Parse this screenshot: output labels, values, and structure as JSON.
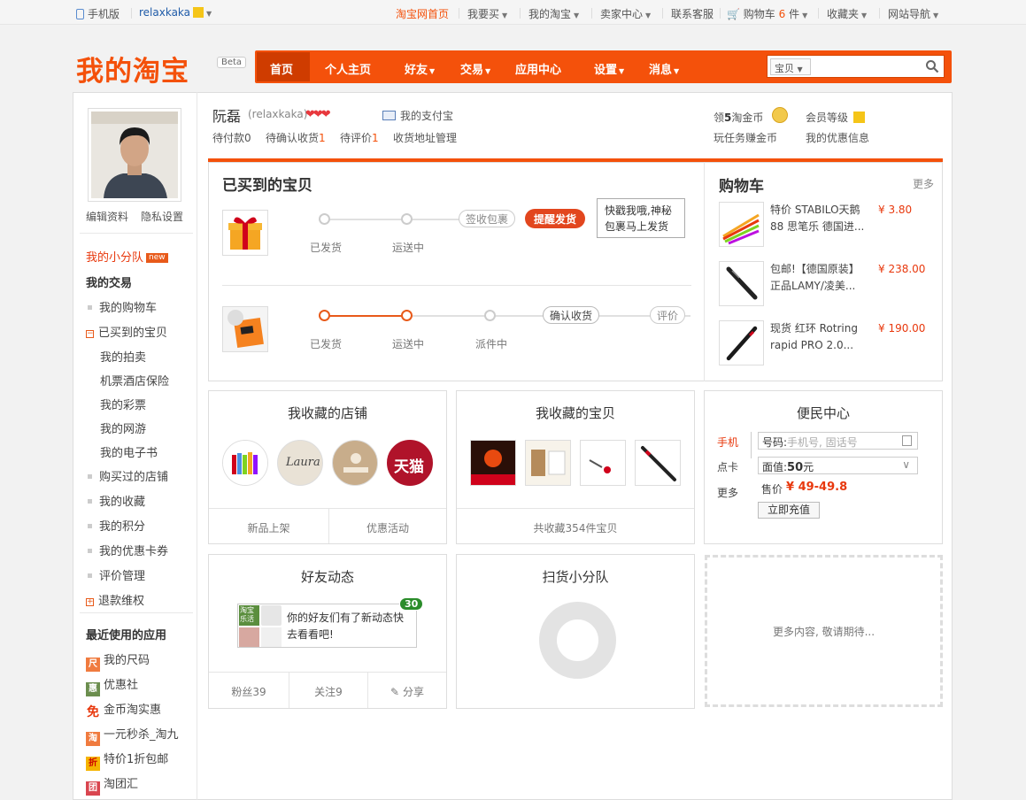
{
  "topbar": {
    "mobile": "手机版",
    "username": "relaxkaka",
    "links": [
      "淘宝网首页",
      "我要买",
      "我的淘宝",
      "卖家中心",
      "联系客服",
      "购物车",
      "收藏夹",
      "网站导航"
    ],
    "cart_count": "6",
    "cart_unit": "件"
  },
  "logo": {
    "text": "我的淘宝",
    "beta": "Beta"
  },
  "nav": {
    "items": [
      "首页",
      "个人主页",
      "好友",
      "交易",
      "应用中心",
      "设置",
      "消息"
    ],
    "search_type": "宝贝"
  },
  "sidebar": {
    "edit_profile": "编辑资料",
    "privacy": "隐私设置",
    "squad": "我的小分队",
    "new_tag": "new",
    "my_trade": "我的交易",
    "items": [
      "我的购物车",
      "已买到的宝贝",
      "我的拍卖",
      "机票酒店保险",
      "我的彩票",
      "我的网游",
      "我的电子书",
      "购买过的店铺",
      "我的收藏",
      "我的积分",
      "我的优惠卡券",
      "评价管理",
      "退款维权"
    ],
    "recent_apps_title": "最近使用的应用",
    "apps": [
      "我的尺码",
      "优惠社",
      "金币淘实惠",
      "一元秒杀_淘九",
      "特价1折包邮",
      "淘团汇"
    ],
    "app_glyphs": [
      "尺",
      "惠",
      "免",
      "淘",
      "折",
      "团"
    ]
  },
  "user": {
    "name": "阮磊",
    "id": "(relaxkaka)",
    "alipay": "我的支付宝",
    "pending_pay_label": "待付款",
    "pending_pay": "0",
    "pending_receive_label": "待确认收货",
    "pending_receive": "1",
    "pending_review_label": "待评价",
    "pending_review": "1",
    "address": "收货地址管理",
    "gold_pre": "领",
    "gold_num": "5",
    "gold_post": "淘金币",
    "task": "玩任务赚金币",
    "member_level": "会员等级",
    "my_offers": "我的优惠信息"
  },
  "bought": {
    "title": "已买到的宝贝",
    "order1": {
      "steps": [
        "已发货",
        "运送中"
      ],
      "sign": "签收包裹",
      "remind": "提醒发货",
      "tip": "快戳我哦,神秘包裹马上发货"
    },
    "order2": {
      "steps": [
        "已发货",
        "运送中",
        "派件中"
      ],
      "confirm": "确认收货",
      "review": "评价"
    }
  },
  "cart": {
    "title": "购物车",
    "more": "更多",
    "items": [
      {
        "name1": "特价 STABILO天鹅",
        "name2": "88 思笔乐 德国进...",
        "price": "¥ 3.80"
      },
      {
        "name1": "包邮!【德国原装】",
        "name2": "正品LAMY/凌美...",
        "price": "¥ 238.00"
      },
      {
        "name1": "现货 红环 Rotring",
        "name2": "rapid PRO 2.0...",
        "price": "¥ 190.00"
      }
    ]
  },
  "shops": {
    "title": "我收藏的店铺",
    "new": "新品上架",
    "promo": "优惠活动",
    "tmall": "天猫",
    "laura": "Laura"
  },
  "goods": {
    "title": "我收藏的宝贝",
    "total": "共收藏354件宝贝"
  },
  "service": {
    "title": "便民中心",
    "tabs": [
      "手机",
      "点卡",
      "更多"
    ],
    "number_label": "号码:",
    "number_placeholder": "手机号, 固话号",
    "value_label": "面值:",
    "value": "50",
    "value_unit": "元",
    "price_label": "售价",
    "price": "¥ 49-49.8",
    "charge": "立即充值"
  },
  "friends": {
    "title": "好友动态",
    "badge": "30",
    "logo_text": "淘宝 乐活",
    "message": "你的好友们有了新动态快去看看吧!",
    "fans": "粉丝39",
    "follow": "关注9",
    "share": "分享"
  },
  "squad": {
    "title": "扫货小分队"
  },
  "placeholder": {
    "text": "更多内容, 敬请期待..."
  },
  "colors": {
    "brand": "#f4510b",
    "price": "#e8380d"
  }
}
